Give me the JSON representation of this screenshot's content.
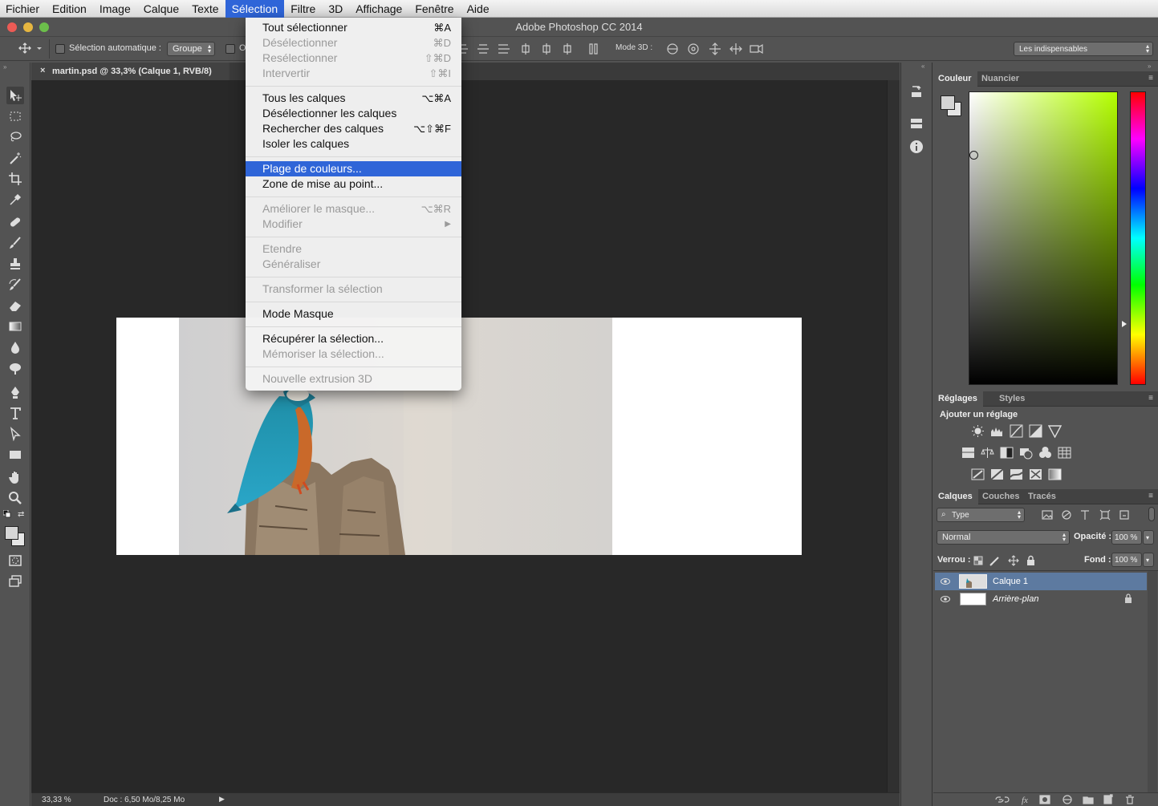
{
  "menubar": {
    "items": [
      "Fichier",
      "Edition",
      "Image",
      "Calque",
      "Texte",
      "Sélection",
      "Filtre",
      "3D",
      "Affichage",
      "Fenêtre",
      "Aide"
    ],
    "active": "Sélection"
  },
  "app_title": "Adobe Photoshop CC 2014",
  "options": {
    "auto_select_label": "Sélection automatique :",
    "auto_select_value": "Groupe",
    "partial_label": "O",
    "mode3d_label": "Mode 3D :",
    "workspace_value": "Les indispensables"
  },
  "document": {
    "tab_title": "martin.psd @ 33,3% (Calque 1, RVB/8)",
    "zoom": "33,33 %",
    "doc_info": "Doc : 6,50 Mo/8,25 Mo"
  },
  "selection_menu": {
    "items": [
      {
        "label": "Tout sélectionner",
        "shortcut": "⌘A",
        "disabled": false
      },
      {
        "label": "Désélectionner",
        "shortcut": "⌘D",
        "disabled": true
      },
      {
        "label": "Resélectionner",
        "shortcut": "⇧⌘D",
        "disabled": true
      },
      {
        "label": "Intervertir",
        "shortcut": "⇧⌘I",
        "disabled": true
      },
      {
        "label": "Tous les calques",
        "shortcut": "⌥⌘A",
        "disabled": false
      },
      {
        "label": "Désélectionner les calques",
        "shortcut": "",
        "disabled": false
      },
      {
        "label": "Rechercher des calques",
        "shortcut": "⌥⇧⌘F",
        "disabled": false
      },
      {
        "label": "Isoler les calques",
        "shortcut": "",
        "disabled": false
      },
      {
        "label": "Plage de couleurs...",
        "shortcut": "",
        "disabled": false,
        "highlighted": true
      },
      {
        "label": "Zone de mise au point...",
        "shortcut": "",
        "disabled": false
      },
      {
        "label": "Améliorer le masque...",
        "shortcut": "⌥⌘R",
        "disabled": true
      },
      {
        "label": "Modifier",
        "shortcut": "▶",
        "disabled": true
      },
      {
        "label": "Etendre",
        "shortcut": "",
        "disabled": true
      },
      {
        "label": "Généraliser",
        "shortcut": "",
        "disabled": true
      },
      {
        "label": "Transformer la sélection",
        "shortcut": "",
        "disabled": true
      },
      {
        "label": "Mode Masque",
        "shortcut": "",
        "disabled": false
      },
      {
        "label": "Récupérer la sélection...",
        "shortcut": "",
        "disabled": false
      },
      {
        "label": "Mémoriser la sélection...",
        "shortcut": "",
        "disabled": true
      },
      {
        "label": "Nouvelle extrusion 3D",
        "shortcut": "",
        "disabled": true
      }
    ]
  },
  "color_panel": {
    "tabs": [
      "Couleur",
      "Nuancier"
    ],
    "hue_color": "#b4ff00"
  },
  "adjustments_panel": {
    "tabs": [
      "Réglages",
      "Styles"
    ],
    "heading": "Ajouter un réglage"
  },
  "layers_panel": {
    "tabs": [
      "Calques",
      "Couches",
      "Tracés"
    ],
    "filter_kind": "Type",
    "blend_mode": "Normal",
    "opacity_label": "Opacité :",
    "opacity_value": "100 %",
    "lock_label": "Verrou :",
    "fill_label": "Fond :",
    "fill_value": "100 %",
    "layers": [
      {
        "name": "Calque 1",
        "selected": true
      },
      {
        "name": "Arrière-plan",
        "selected": false,
        "locked": true
      }
    ]
  },
  "colors": {
    "accent": "#2f65d8",
    "panel": "#535353",
    "canvas_bg": "#282828"
  }
}
